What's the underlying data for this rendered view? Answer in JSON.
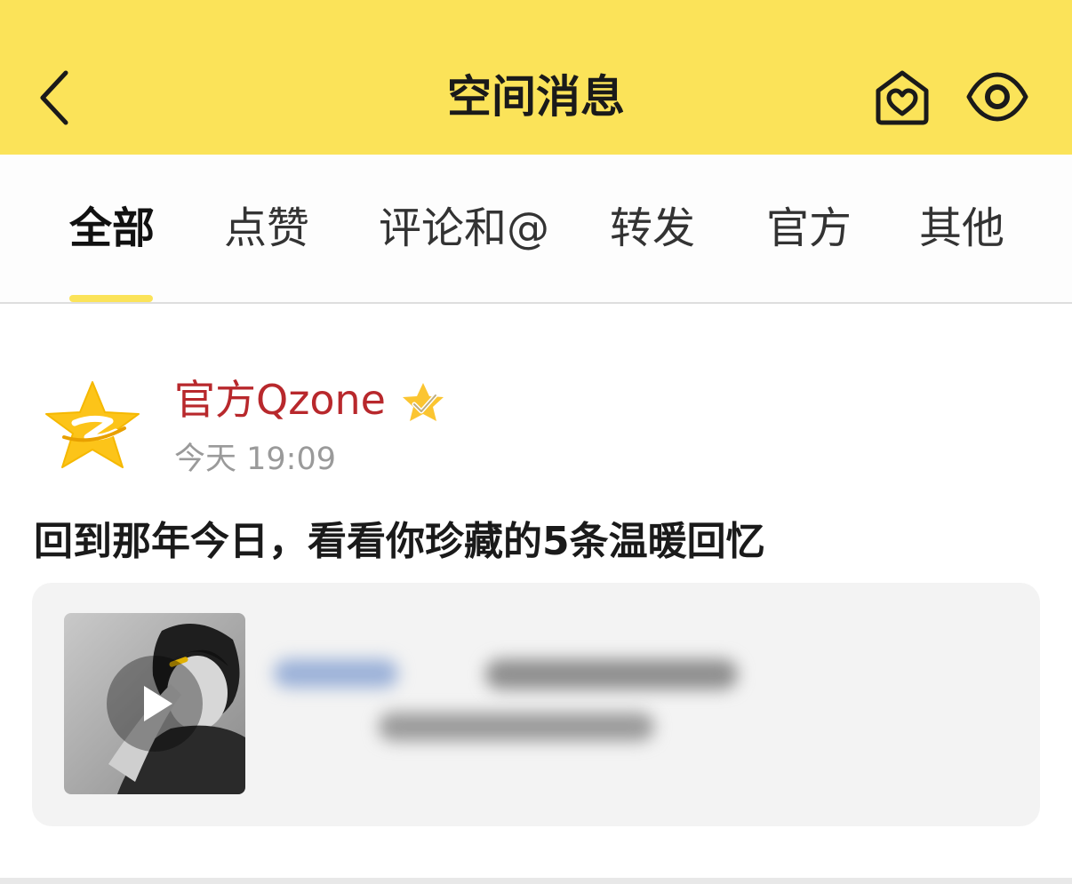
{
  "header": {
    "title": "空间消息",
    "background_color": "#fbe359"
  },
  "tabs": [
    {
      "label": "全部",
      "active": true
    },
    {
      "label": "点赞",
      "active": false
    },
    {
      "label": "评论和@",
      "active": false
    },
    {
      "label": "转发",
      "active": false
    },
    {
      "label": "官方",
      "active": false
    },
    {
      "label": "其他",
      "active": false
    }
  ],
  "message": {
    "sender": "官方Qzone",
    "sender_color": "#b8282c",
    "time": "今天 19:09",
    "text": "回到那年今日，看看你珍藏的5条温暖回忆",
    "shared_item": {
      "thumbnail": "video-thumbnail",
      "play_icon": "play-icon",
      "text_blurred": true
    }
  },
  "icons": {
    "back": "back-chevron-icon",
    "home": "home-heart-icon",
    "visitors": "eye-icon",
    "avatar": "qzone-star-logo",
    "verified": "verified-star-icon"
  }
}
